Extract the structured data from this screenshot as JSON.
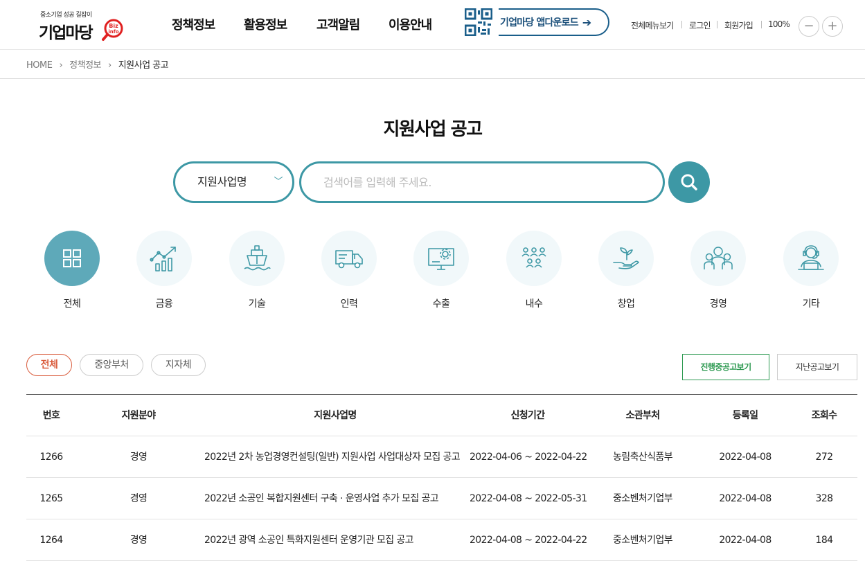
{
  "header": {
    "logo": {
      "tagline": "중소기업 성공 길잡이",
      "name": "기업마당",
      "badge_top": "Biz",
      "badge_bottom": "info"
    },
    "gnb": [
      "정책정보",
      "활용정보",
      "고객알림",
      "이용안내"
    ],
    "app_download": "기업마당 앱다운로드",
    "utils": [
      "전체메뉴보기",
      "로그인",
      "회원가입"
    ],
    "zoom": "100%",
    "zoom_out": "−",
    "zoom_in": "+"
  },
  "breadcrumb": {
    "home": "HOME",
    "sep": "›",
    "level1": "정책정보",
    "current": "지원사업 공고"
  },
  "page_title": "지원사업 공고",
  "search": {
    "select_value": "지원사업명",
    "placeholder": "검색어를 입력해 주세요."
  },
  "categories": [
    {
      "label": "전체",
      "icon": "grid-icon",
      "active": true
    },
    {
      "label": "금융",
      "icon": "growth-chart-icon"
    },
    {
      "label": "기술",
      "icon": "ship-icon"
    },
    {
      "label": "인력",
      "icon": "truck-icon"
    },
    {
      "label": "수출",
      "icon": "monitor-gear-icon"
    },
    {
      "label": "내수",
      "icon": "people-group-icon"
    },
    {
      "label": "창업",
      "icon": "sprout-hand-icon"
    },
    {
      "label": "경영",
      "icon": "team-icon"
    },
    {
      "label": "기타",
      "icon": "headset-user-icon"
    }
  ],
  "filters": {
    "all": "전체",
    "central": "중앙부처",
    "local": "지자체"
  },
  "view_buttons": {
    "ongoing": "진행중공고보기",
    "past": "지난공고보기"
  },
  "colors": {
    "accent": "#3d98a5",
    "category_active": "#5ea9b9",
    "filter_active": "#d95a3a",
    "ongoing_btn": "#2e9a52"
  },
  "table": {
    "headers": [
      "번호",
      "지원분야",
      "지원사업명",
      "신청기간",
      "소관부처",
      "등록일",
      "조회수"
    ],
    "rows": [
      [
        "1266",
        "경영",
        "2022년 2차 농업경영컨설팅(일반) 지원사업 사업대상자 모집 공고",
        "2022-04-06 ~ 2022-04-22",
        "농림축산식품부",
        "2022-04-08",
        "272"
      ],
      [
        "1265",
        "경영",
        "2022년 소공인 복합지원센터 구축 · 운영사업 추가 모집 공고",
        "2022-04-08 ~ 2022-05-31",
        "중소벤처기업부",
        "2022-04-08",
        "328"
      ],
      [
        "1264",
        "경영",
        "2022년 광역 소공인 특화지원센터 운영기관 모집 공고",
        "2022-04-08 ~ 2022-04-22",
        "중소벤처기업부",
        "2022-04-08",
        "184"
      ]
    ]
  }
}
